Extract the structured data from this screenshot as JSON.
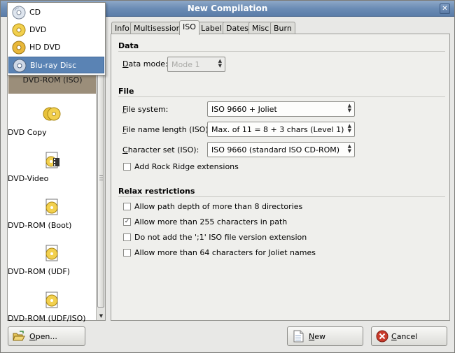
{
  "window": {
    "title": "New Compilation",
    "close_glyph": "✕"
  },
  "menu": {
    "items": [
      {
        "label": "CD",
        "icon": "cd-disc-icon"
      },
      {
        "label": "DVD",
        "icon": "dvd-disc-icon"
      },
      {
        "label": "HD DVD",
        "icon": "hd-dvd-disc-icon"
      },
      {
        "label": "Blu-ray Disc",
        "icon": "bluray-disc-icon",
        "selected": true
      }
    ]
  },
  "project_list": {
    "selected_label": "DVD-ROM (ISO)",
    "items": [
      {
        "label": "DVD Copy",
        "icon": "dvd-copy-icon"
      },
      {
        "label": "DVD-Video",
        "icon": "dvd-video-icon"
      },
      {
        "label": "DVD-ROM (Boot)",
        "icon": "dvd-boot-icon"
      },
      {
        "label": "DVD-ROM (UDF)",
        "icon": "dvd-udf-icon"
      },
      {
        "label": "DVD-ROM (UDF/ISO)",
        "icon": "dvd-udf-iso-icon"
      }
    ]
  },
  "tabs": [
    {
      "label": "Info"
    },
    {
      "label": "Multisession"
    },
    {
      "label": "ISO",
      "active": true
    },
    {
      "label": "Label"
    },
    {
      "label": "Dates"
    },
    {
      "label": "Misc"
    },
    {
      "label": "Burn"
    }
  ],
  "data_section": {
    "title": "Data",
    "data_mode_label_u": "D",
    "data_mode_label_rest": "ata mode:",
    "data_mode_value": "Mode 1"
  },
  "file_section": {
    "title": "File",
    "fs_label_u": "F",
    "fs_label_rest": "ile system:",
    "fs_value": "ISO 9660 + Joliet",
    "fnl_label_u": "F",
    "fnl_label_rest": "ile name length (ISO):",
    "fnl_value": "Max. of 11 = 8 + 3 chars (Level 1)",
    "charset_label_u": "C",
    "charset_label_rest": "haracter set (ISO):",
    "charset_value": "ISO 9660  (standard ISO CD-ROM)",
    "rock_ridge_label": "Add Rock Ridge extensions",
    "rock_ridge_checked": false
  },
  "relax_section": {
    "title": "Relax restrictions",
    "options": [
      {
        "label": "Allow path depth of more than 8 directories",
        "checked": false
      },
      {
        "label": "Allow more than 255 characters in path",
        "checked": true
      },
      {
        "label": "Do not add the ';1' ISO file version extension",
        "checked": false
      },
      {
        "label": "Allow more than 64 characters for Joliet names",
        "checked": false
      }
    ]
  },
  "buttons": {
    "open_u": "O",
    "open_rest": "pen...",
    "new_u": "N",
    "new_rest": "ew",
    "cancel_u": "C",
    "cancel_rest": "ancel"
  },
  "colors": {
    "selection": "#5a83b4",
    "titlebar": "#6b8cb5",
    "cancel_red": "#c93a2a"
  }
}
